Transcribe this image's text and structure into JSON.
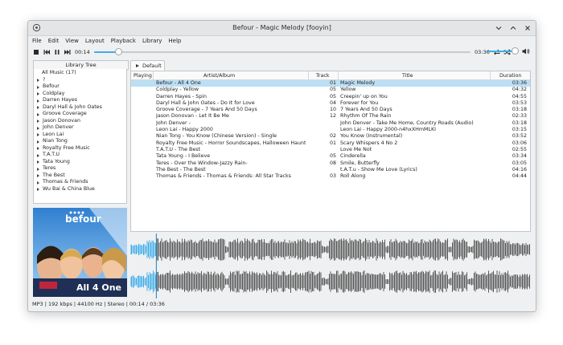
{
  "window": {
    "title": "Befour - Magic Melody [fooyin]"
  },
  "menu": [
    "File",
    "Edit",
    "View",
    "Layout",
    "Playback",
    "Library",
    "Help"
  ],
  "toolbar": {
    "elapsed": "00:14",
    "remaining": "03:36",
    "progress": 0.065,
    "volume": 0.9
  },
  "library": {
    "header": "Library Tree",
    "root": "All Music (17)",
    "items": [
      "?",
      "Befour",
      "Coldplay",
      "Darren Hayes",
      "Daryl Hall & John Oates",
      "Groove Coverage",
      "Jason Donovan",
      "John Denver",
      "Leon Lai",
      "Nian Tong",
      "Royalty Free Music",
      "T.A.T.U",
      "Tata Young",
      "Teres",
      "The Best",
      "Thomas & Friends",
      "Wu Bai & China Blue"
    ]
  },
  "cover_art": {
    "brand": "befour",
    "album": "All 4 One"
  },
  "playlist": {
    "tab": "Default",
    "columns": {
      "playing": "Playing",
      "artist": "Artist/Album",
      "track": "Track",
      "title": "Title",
      "duration": "Duration"
    },
    "rows": [
      {
        "artist": "Befour - All 4 One",
        "track": "01",
        "title": "Magic  Melody",
        "duration": "03:36",
        "playing": true
      },
      {
        "artist": "Coldplay - Yellow",
        "track": "05",
        "title": "Yellow",
        "duration": "04:32"
      },
      {
        "artist": "Darren Hayes - Spin",
        "track": "05",
        "title": "Creepin' up on You",
        "duration": "04:55"
      },
      {
        "artist": "Daryl Hall & John Oates - Do It for Love",
        "track": "04",
        "title": "Forever for You",
        "duration": "03:53"
      },
      {
        "artist": "Groove Coverage - 7 Years And 50 Days",
        "track": "10",
        "title": "7 Years And 50 Days",
        "duration": "03:18"
      },
      {
        "artist": "Jason Donovan - Let It Be Me",
        "track": "12",
        "title": "Rhythm Of The Rain",
        "duration": "02:33"
      },
      {
        "artist": "John Denver -",
        "track": "",
        "title": "John Denver - Take Me Home, Country Roads (Audio)",
        "duration": "03:18"
      },
      {
        "artist": "Leon Lai - Happy 2000",
        "track": "",
        "title": "Leon Lai - Happy 2000-n4hxXHmMLKI",
        "duration": "03:15"
      },
      {
        "artist": "Nian Tong - You Know (Chinese Version) - Single",
        "track": "02",
        "title": "You Know (Instrumental)",
        "duration": "03:52"
      },
      {
        "artist": "Royalty Free Music - Horror Soundscapes, Halloween Haunt...",
        "track": "01",
        "title": "Scary Whispers 4 No 2",
        "duration": "03:06"
      },
      {
        "artist": "T.A.T.U - The Best",
        "track": "",
        "title": "Love Me Not",
        "duration": "02:55"
      },
      {
        "artist": "Tata Young - I Believe",
        "track": "05",
        "title": "Cinderella",
        "duration": "03:34"
      },
      {
        "artist": "Teres - Over the Window-Jazzy Rain-",
        "track": "08",
        "title": "Smile, Butterfly",
        "duration": "03:05"
      },
      {
        "artist": "The Best - The Best",
        "track": "",
        "title": "t.A.T.u - Show Me Love (Lyrics)",
        "duration": "04:16"
      },
      {
        "artist": "Thomas & Friends - Thomas & Friends: All Star Tracks",
        "track": "03",
        "title": "Roll Along",
        "duration": "04:44"
      }
    ]
  },
  "status": "MP3 | 192 kbps | 44100 Hz | Stereo | 00:14 / 03:36",
  "colors": {
    "accent": "#3daee9",
    "selection": "#bcdff4",
    "wave_played": "#3daee9",
    "wave_unplayed": "#5a5a5a"
  }
}
